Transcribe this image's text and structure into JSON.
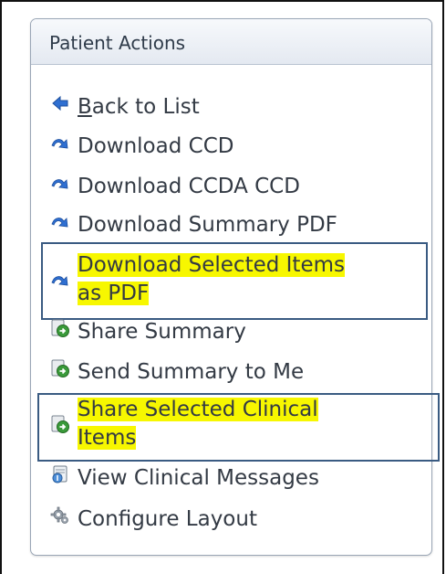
{
  "panel": {
    "title": "Patient Actions"
  },
  "items": [
    {
      "name": "back-to-list",
      "label_first": "B",
      "label_rest": "ack to List",
      "icon": "arrow-left-icon"
    },
    {
      "name": "download-ccd",
      "label": "Download CCD",
      "icon": "download-arrow-icon"
    },
    {
      "name": "download-ccda-ccd",
      "label": "Download CCDA CCD",
      "icon": "download-arrow-icon"
    },
    {
      "name": "download-summary-pdf",
      "label": "Download Summary PDF",
      "icon": "download-arrow-icon"
    },
    {
      "name": "download-selected-items-pdf",
      "line1": "Download Selected Items",
      "line2": "as PDF",
      "icon": "download-arrow-icon",
      "highlighted": true
    },
    {
      "name": "share-summary",
      "label": "Share Summary",
      "icon": "share-doc-icon"
    },
    {
      "name": "send-summary-to-me",
      "label": "Send Summary to Me",
      "icon": "share-doc-icon"
    },
    {
      "name": "share-selected-clinical-items",
      "line1": "Share Selected Clinical",
      "line2": "Items",
      "icon": "share-doc-icon",
      "highlighted": true
    },
    {
      "name": "view-clinical-messages",
      "label": "View Clinical Messages",
      "icon": "messages-icon"
    },
    {
      "name": "configure-layout",
      "label": "Configure Layout",
      "icon": "gear-icon"
    }
  ],
  "colors": {
    "highlight": "#f7f700",
    "box_outline": "#3a5b82",
    "link_text": "#333a44",
    "icon_blue": "#2f6fd1",
    "icon_green": "#3a9a3a"
  }
}
